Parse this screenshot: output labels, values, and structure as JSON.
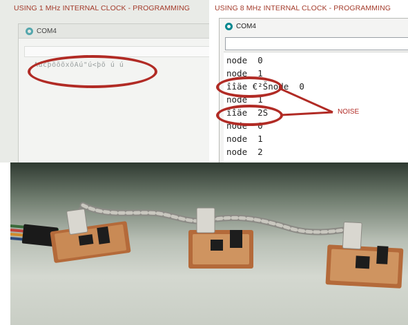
{
  "left_panel": {
    "caption": "USING 1 MHz INTERNAL CLOCK - PROGRAMMING",
    "window_title": "COM4",
    "garbled_output": "AúcþõõõxõAú\"ú<þõ  ú  ú"
  },
  "right_panel": {
    "caption": "USING 8 MHz INTERNAL CLOCK - PROGRAMMING",
    "window_title": "COM4",
    "lines": [
      "node  0",
      "node  1",
      "îîäe €²Šnode  0",
      "node  1",
      "îîäe  2Š",
      "node  0",
      "node  1",
      "node  2"
    ],
    "annotation": "NOISE"
  },
  "colors": {
    "caption": "#a33a2a",
    "annotation": "#b12b25",
    "arduino_teal": "#00878f"
  }
}
